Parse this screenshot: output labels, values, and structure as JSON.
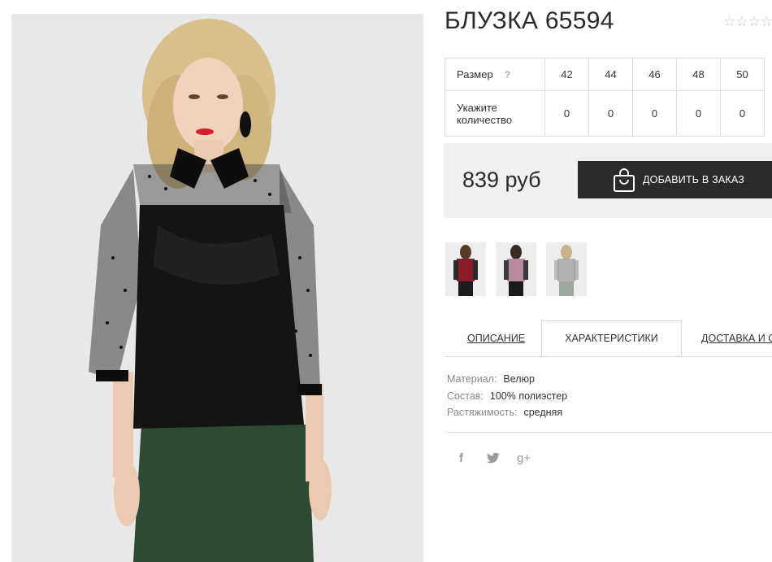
{
  "product": {
    "title": "БЛУЗКА 65594",
    "rating_stars": "☆☆☆☆☆"
  },
  "size_table": {
    "size_label": "Размер",
    "size_hint": "?",
    "sizes": [
      "42",
      "44",
      "46",
      "48",
      "50"
    ],
    "quantity_label_line1": "Укажите",
    "quantity_label_line2": "количество",
    "quantities": [
      "0",
      "0",
      "0",
      "0",
      "0"
    ]
  },
  "purchase": {
    "price": "839 руб",
    "add_button_label": "ДОБАВИТЬ В ЗАКАЗ",
    "add_button_icon": "shopping-bag-icon"
  },
  "thumbnails": [
    {
      "name": "thumb-burgundy",
      "color": "#8b1a2a"
    },
    {
      "name": "thumb-pink",
      "color": "#b88aa0"
    },
    {
      "name": "thumb-black",
      "color": "#1c1c1c"
    }
  ],
  "tabs": [
    {
      "label": "ОПИСАНИЕ",
      "active": false
    },
    {
      "label": "ХАРАКТЕРИСТИКИ",
      "active": true
    },
    {
      "label": "ДОСТАВКА И ОПЛАТА",
      "active": false
    }
  ],
  "specs": [
    {
      "key": "Материал:",
      "value": "Велюр"
    },
    {
      "key": "Состав:",
      "value": "100% полиэстер"
    },
    {
      "key": "Растяжимость:",
      "value": "средняя"
    }
  ],
  "social": [
    {
      "glyph": "f",
      "icon": "facebook-icon"
    },
    {
      "glyph": "🐦",
      "icon": "twitter-icon"
    },
    {
      "glyph": "g+",
      "icon": "google-plus-icon"
    }
  ],
  "colors": {
    "button_bg": "#2b2b2b",
    "price_box_bg": "#f0f0f0",
    "image_bg": "#e9e9e9"
  }
}
